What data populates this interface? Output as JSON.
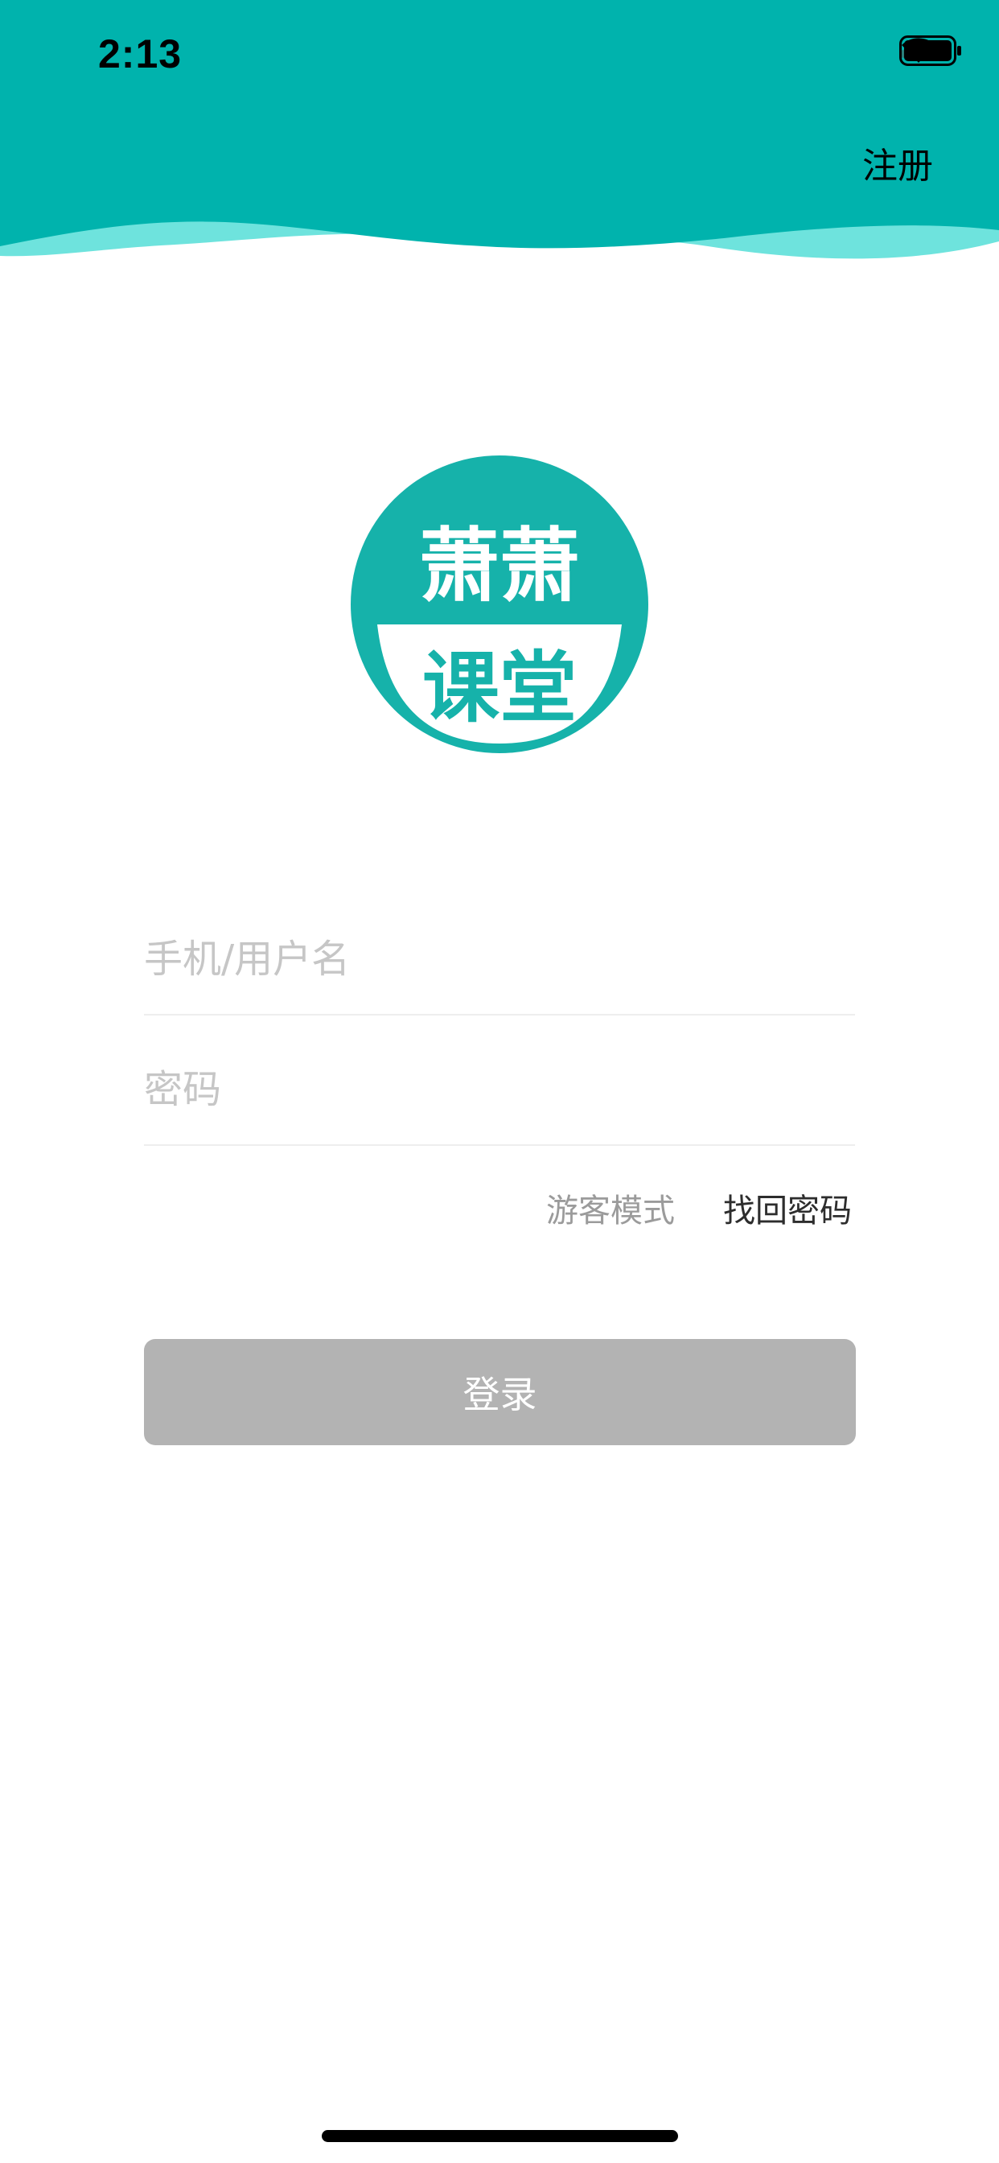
{
  "status_bar": {
    "time": "2:13",
    "icons": [
      "cellular-signal-icon",
      "wifi-icon",
      "battery-icon"
    ]
  },
  "header": {
    "register_label": "注册"
  },
  "logo": {
    "line1": "萧萧",
    "line2": "课堂"
  },
  "form": {
    "username_placeholder": "手机/用户名",
    "username_value": "",
    "password_placeholder": "密码",
    "password_value": ""
  },
  "links": {
    "guest_mode": "游客模式",
    "forgot_password": "找回密码"
  },
  "login_button": {
    "label": "登录"
  },
  "colors": {
    "header_teal": "#00b3ad",
    "wave_light": "#6ee3dd",
    "logo_teal": "#16b2aa",
    "button_disabled": "#b3b3b3"
  }
}
